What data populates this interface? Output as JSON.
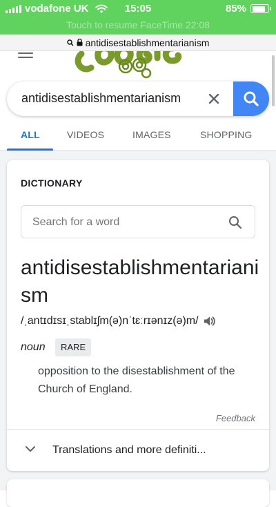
{
  "status_bar": {
    "carrier": "vodafone UK",
    "time": "15:05",
    "battery": "85%",
    "battery_level": 0.85,
    "banner": "Touch to resume FaceTime 22:08"
  },
  "url_bar": {
    "url": "antidisestablishmentarianism"
  },
  "search": {
    "query": "antidisestablishmentarianism"
  },
  "tabs": [
    {
      "label": "ALL"
    },
    {
      "label": "VIDEOS"
    },
    {
      "label": "IMAGES"
    },
    {
      "label": "SHOPPING"
    }
  ],
  "dictionary": {
    "title": "DICTIONARY",
    "placeholder": "Search for a word",
    "word": "antidisestablishmentarianism",
    "phonetic": "/ˌantɪdɪsɪˌstablɪʃm(ə)nˈtɛːrɪənɪz(ə)m/",
    "part_of_speech": "noun",
    "register_tag": "RARE",
    "definition": "opposition to the disestablishment of the Church of England.",
    "feedback": "Feedback",
    "more_label": "Translations and more definiti..."
  },
  "colors": {
    "status_green": "#5fd35d",
    "google_blue": "#4285f4",
    "tab_active": "#1a73e8",
    "doodle_green": "#7a9a2c"
  },
  "icons": [
    "signal-icon",
    "wifi-icon",
    "battery-icon",
    "magnifier-icon",
    "lock-icon",
    "hamburger-icon",
    "clear-icon",
    "search-icon",
    "speaker-icon",
    "chevron-down-icon"
  ]
}
